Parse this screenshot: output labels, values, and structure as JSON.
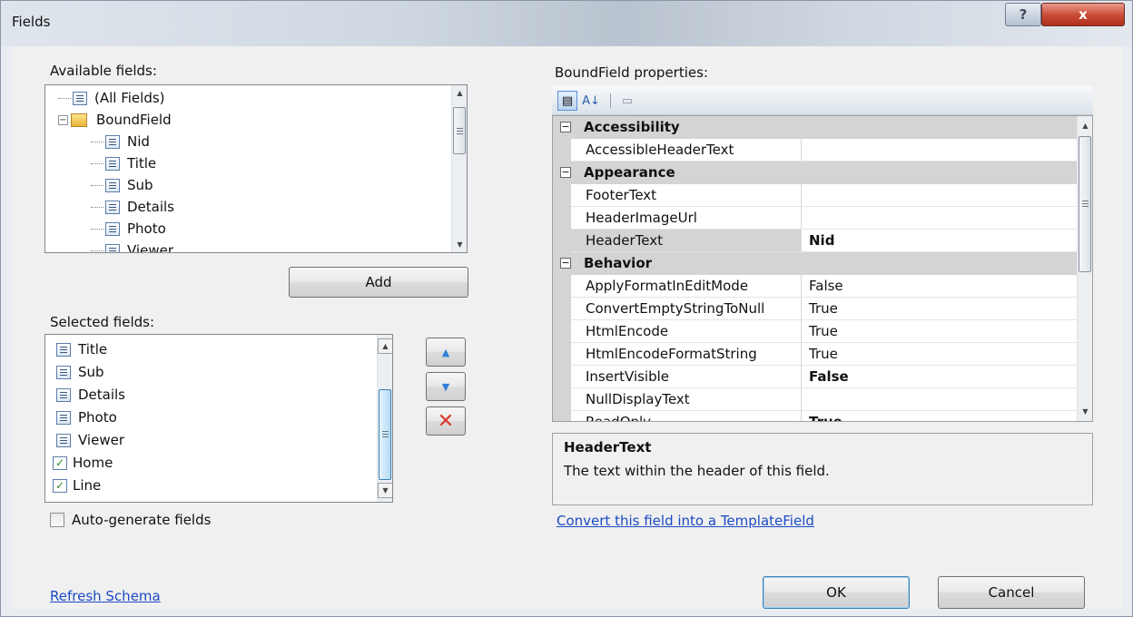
{
  "window": {
    "title": "Fields",
    "help_glyph": "?",
    "close_glyph": "x"
  },
  "available": {
    "label": "Available fields:",
    "items": [
      {
        "label": "(All Fields)"
      },
      {
        "label": "BoundField"
      },
      {
        "label": "Nid"
      },
      {
        "label": "Title"
      },
      {
        "label": "Sub"
      },
      {
        "label": "Details"
      },
      {
        "label": "Photo"
      },
      {
        "label": "Viewer"
      }
    ],
    "expand_glyph": "−"
  },
  "add_button": "Add",
  "selected": {
    "label": "Selected fields:",
    "items": [
      {
        "label": "Title",
        "icon": "bound-field-icon"
      },
      {
        "label": "Sub",
        "icon": "bound-field-icon"
      },
      {
        "label": "Details",
        "icon": "bound-field-icon"
      },
      {
        "label": "Photo",
        "icon": "bound-field-icon"
      },
      {
        "label": "Viewer",
        "icon": "bound-field-icon"
      },
      {
        "label": "Home",
        "icon": "checkbox-field-icon"
      },
      {
        "label": "Line",
        "icon": "checkbox-field-icon"
      }
    ]
  },
  "move_controls": {
    "up_glyph": "▲",
    "down_glyph": "▼",
    "delete_glyph": "✕"
  },
  "autogen": {
    "label": "Auto-generate fields",
    "checked": false
  },
  "refresh_link": "Refresh Schema",
  "properties": {
    "label": "BoundField properties:",
    "toolbar": {
      "categorized_glyph": "▤",
      "alphabetical_glyph": "A↓",
      "pages_glyph": "▭"
    },
    "toggle_glyph": "−",
    "categories": [
      {
        "name": "Accessibility",
        "rows": [
          {
            "name": "AccessibleHeaderText",
            "value": ""
          }
        ]
      },
      {
        "name": "Appearance",
        "rows": [
          {
            "name": "FooterText",
            "value": ""
          },
          {
            "name": "HeaderImageUrl",
            "value": ""
          },
          {
            "name": "HeaderText",
            "value": "Nid"
          }
        ]
      },
      {
        "name": "Behavior",
        "rows": [
          {
            "name": "ApplyFormatInEditMode",
            "value": "False"
          },
          {
            "name": "ConvertEmptyStringToNull",
            "value": "True"
          },
          {
            "name": "HtmlEncode",
            "value": "True"
          },
          {
            "name": "HtmlEncodeFormatString",
            "value": "True"
          },
          {
            "name": "InsertVisible",
            "value": "False"
          },
          {
            "name": "NullDisplayText",
            "value": ""
          },
          {
            "name": "ReadOnly",
            "value": "True"
          }
        ]
      }
    ],
    "description": {
      "title": "HeaderText",
      "text": "The text within the header of this field."
    }
  },
  "convert_link": "Convert this field into a TemplateField",
  "ok_button": "OK",
  "cancel_button": "Cancel",
  "colors": {
    "link": "#1a4ac4",
    "delete": "#d9372b",
    "arrow": "#2f7fd8"
  }
}
